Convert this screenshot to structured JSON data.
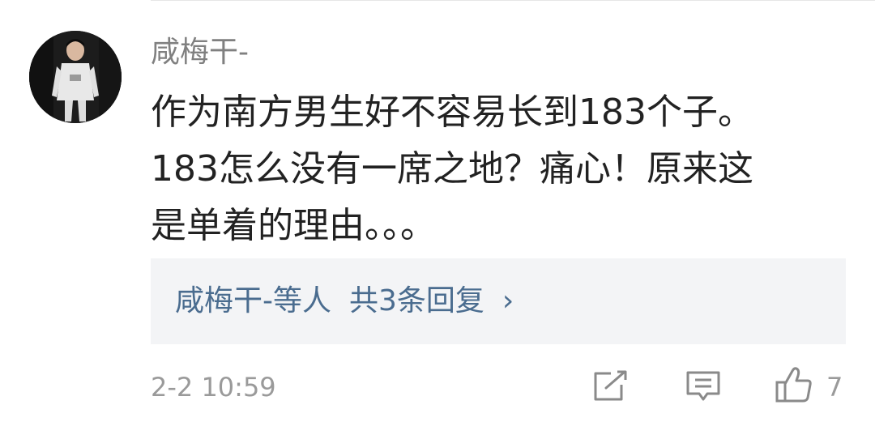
{
  "comment": {
    "username": "咸梅干-",
    "text_lines": [
      "作为南方男生好不容易长到183个子。",
      "183怎么没有一席之地？痛心！原来这",
      "是单着的理由。。。"
    ],
    "reply_summary": {
      "names": "咸梅干-等人",
      "count_text": "共3条回复",
      "chevron": "›"
    },
    "timestamp": "2-2 10:59",
    "actions": {
      "share_icon": "edit-share-icon",
      "comment_icon": "comment-bubble-icon",
      "like_icon": "thumbs-up-icon",
      "like_count": "7"
    }
  },
  "colors": {
    "username": "#808080",
    "text": "#222222",
    "reply_link": "#4a6c8f",
    "reply_bg": "#f3f4f6",
    "meta": "#9a9a9a"
  }
}
